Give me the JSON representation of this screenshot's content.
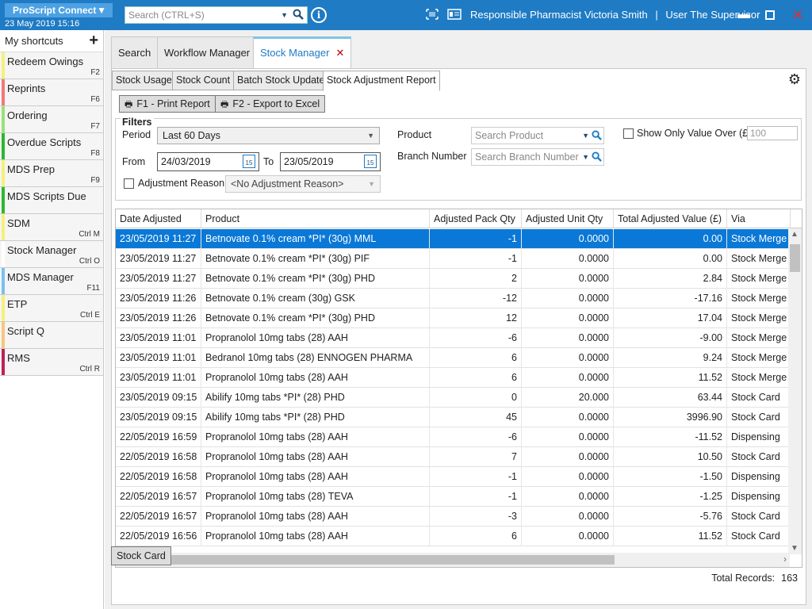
{
  "titlebar": {
    "app_name": "ProScript Connect",
    "date": "23 May 2019 15:16",
    "search_placeholder": "Search (CTRL+S)",
    "info": "i",
    "pharmacist_label": "Responsible Pharmacist",
    "pharmacist_name": "Victoria Smith",
    "user_label": "User",
    "user_name": "The Supervisor"
  },
  "sidebar": {
    "header": "My shortcuts",
    "items": [
      {
        "label": "Redeem Owings",
        "key": "F2",
        "color": "#f5f07a"
      },
      {
        "label": "Reprints",
        "key": "F6",
        "color": "#f07a7a"
      },
      {
        "label": "Ordering",
        "key": "F7",
        "color": "#9be07a"
      },
      {
        "label": "Overdue Scripts",
        "key": "F8",
        "color": "#2cb82c"
      },
      {
        "label": "MDS Prep",
        "key": "F9",
        "color": "#f5f07a"
      },
      {
        "label": "MDS Scripts Due",
        "key": "",
        "color": "#2cb82c"
      },
      {
        "label": "SDM",
        "key": "Ctrl M",
        "color": "#f5f07a"
      },
      {
        "label": "Stock Manager",
        "key": "Ctrl O",
        "color": "#ffffff"
      },
      {
        "label": "MDS Manager",
        "key": "F11",
        "color": "#7ac0f0"
      },
      {
        "label": "ETP",
        "key": "Ctrl E",
        "color": "#f5f07a"
      },
      {
        "label": "Script Q",
        "key": "",
        "color": "#f5c87a"
      },
      {
        "label": "RMS",
        "key": "Ctrl R",
        "color": "#c0205a"
      }
    ]
  },
  "tabs": {
    "search": "Search",
    "workflow": "Workflow Manager",
    "stock": "Stock Manager"
  },
  "subtabs": {
    "usage": "Stock Usage",
    "count": "Stock Count",
    "batch": "Batch Stock Update",
    "adjustment": "Stock Adjustment Report"
  },
  "buttons": {
    "print": "F1 - Print Report",
    "export": "F2 - Export to Excel",
    "stock_card": "Stock Card"
  },
  "filters": {
    "title": "Filters",
    "period_label": "Period",
    "period_value": "Last 60 Days",
    "from_label": "From",
    "from_value": "24/03/2019",
    "to_label": "To",
    "to_value": "23/05/2019",
    "calendar_day": "15",
    "adj_reason_label": "Adjustment Reason",
    "adj_reason_value": "<No Adjustment Reason>",
    "product_label": "Product",
    "product_placeholder": "Search Product",
    "branch_label": "Branch Number",
    "branch_placeholder": "Search Branch Number",
    "value_over_label": "Show Only Value Over (£)",
    "value_over_placeholder": "100"
  },
  "table": {
    "columns": [
      "Date Adjusted",
      "Product",
      "Adjusted Pack Qty",
      "Adjusted Unit Qty",
      "Total Adjusted Value (£)",
      "Via"
    ],
    "rows": [
      [
        "23/05/2019 11:27",
        "Betnovate 0.1% cream *PI* (30g) MML",
        "-1",
        "0.0000",
        "0.00",
        "Stock Merge"
      ],
      [
        "23/05/2019 11:27",
        "Betnovate 0.1% cream *PI* (30g) PIF",
        "-1",
        "0.0000",
        "0.00",
        "Stock Merge"
      ],
      [
        "23/05/2019 11:27",
        "Betnovate 0.1% cream *PI* (30g) PHD",
        "2",
        "0.0000",
        "2.84",
        "Stock Merge"
      ],
      [
        "23/05/2019 11:26",
        "Betnovate 0.1% cream (30g) GSK",
        "-12",
        "0.0000",
        "-17.16",
        "Stock Merge"
      ],
      [
        "23/05/2019 11:26",
        "Betnovate 0.1% cream *PI* (30g) PHD",
        "12",
        "0.0000",
        "17.04",
        "Stock Merge"
      ],
      [
        "23/05/2019 11:01",
        "Propranolol 10mg tabs (28) AAH",
        "-6",
        "0.0000",
        "-9.00",
        "Stock Merge"
      ],
      [
        "23/05/2019 11:01",
        "Bedranol 10mg tabs (28) ENNOGEN PHARMA",
        "6",
        "0.0000",
        "9.24",
        "Stock Merge"
      ],
      [
        "23/05/2019 11:01",
        "Propranolol 10mg tabs (28) AAH",
        "6",
        "0.0000",
        "11.52",
        "Stock Merge"
      ],
      [
        "23/05/2019 09:15",
        "Abilify 10mg tabs *PI* (28) PHD",
        "0",
        "20.000",
        "63.44",
        "Stock Card"
      ],
      [
        "23/05/2019 09:15",
        "Abilify 10mg tabs *PI* (28) PHD",
        "45",
        "0.0000",
        "3996.90",
        "Stock Card"
      ],
      [
        "22/05/2019 16:59",
        "Propranolol 10mg tabs (28) AAH",
        "-6",
        "0.0000",
        "-11.52",
        "Dispensing"
      ],
      [
        "22/05/2019 16:58",
        "Propranolol 10mg tabs (28) AAH",
        "7",
        "0.0000",
        "10.50",
        "Stock Card"
      ],
      [
        "22/05/2019 16:58",
        "Propranolol 10mg tabs (28) AAH",
        "-1",
        "0.0000",
        "-1.50",
        "Dispensing"
      ],
      [
        "22/05/2019 16:57",
        "Propranolol 10mg tabs (28) TEVA",
        "-1",
        "0.0000",
        "-1.25",
        "Dispensing"
      ],
      [
        "22/05/2019 16:57",
        "Propranolol 10mg tabs (28) AAH",
        "-3",
        "0.0000",
        "-5.76",
        "Stock Card"
      ],
      [
        "22/05/2019 16:56",
        "Propranolol 10mg tabs (28) AAH",
        "6",
        "0.0000",
        "11.52",
        "Stock Card"
      ]
    ]
  },
  "footer": {
    "total_label": "Total Records:",
    "total_value": "163"
  }
}
